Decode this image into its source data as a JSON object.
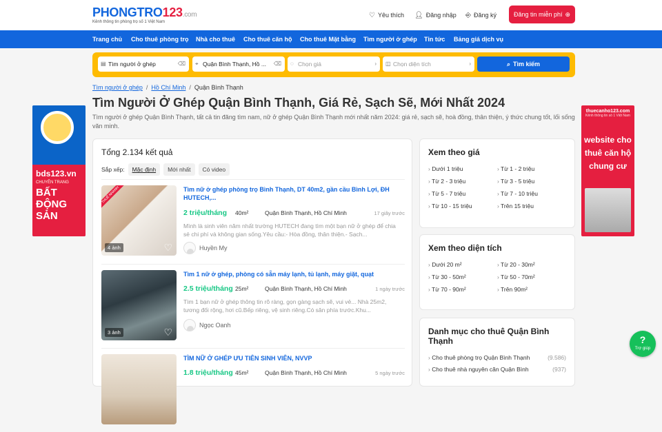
{
  "header": {
    "logo_main": "PHONGTRO",
    "logo_num": "123",
    "logo_domain": ".com",
    "tagline": "Kênh thông tin phòng trọ số 1 Việt Nam",
    "favorite": "Yêu thích",
    "login": "Đăng nhập",
    "register": "Đăng ký",
    "post_button": "Đăng tin miễn phí"
  },
  "menu": [
    "Trang chủ",
    "Cho thuê phòng trọ",
    "Nhà cho thuê",
    "Cho thuê căn hộ",
    "Cho thuê Mặt bằng",
    "Tìm người ở ghép",
    "Tin tức",
    "Bảng giá dịch vụ"
  ],
  "search": {
    "category": "Tìm người ở ghép",
    "location": "Quận Bình Thạnh, Hồ ...",
    "price_placeholder": "Chọn giá",
    "area_placeholder": "Chọn diện tích",
    "button": "Tìm kiếm"
  },
  "breadcrumb": [
    "Tìm người ở ghép",
    "Hồ Chí Minh",
    "Quận Bình Thạnh"
  ],
  "page": {
    "title": "Tìm Người Ở Ghép Quận Bình Thạnh, Giá Rẻ, Sạch Sẽ, Mới Nhất 2024",
    "description": "Tìm người ở ghép Quận Bình Thạnh, tất cả tin đăng tìm nam, nữ ở ghép Quận Bình Thạnh mới nhất năm 2024: giá rẻ, sạch sẽ, hoà đồng, thân thiện, ý thức chung tốt, lối sống văn minh."
  },
  "ads": {
    "left_brand": "bds123.vn",
    "left_tag": "CHUYÊN TRANG",
    "left_big": "BẤT ĐỘNG SẢN",
    "right_brand": "thuecanho123.com",
    "right_tag": "Kênh thông tin số 1 Việt Nam",
    "right_big": "website cho thuê căn hộ chung cư"
  },
  "results": {
    "total": "Tổng 2.134 kết quả",
    "sort_label": "Sắp xếp:",
    "sort_options": [
      "Mặc định",
      "Mới nhất",
      "Có video"
    ]
  },
  "listings": [
    {
      "title": "Tìm nữ ở ghép phòng trọ Bình Thạnh, DT 40m2, gần cầu Bình Lợi, ĐH HUTECH,...",
      "price": "2 triệu/tháng",
      "area": "40m²",
      "location": "Quận Bình Thạnh, Hồ Chí Minh",
      "time": "17 giây trước",
      "summary": "Mình là sinh viên năm nhất trường HUTECH đang tìm một bạn nữ ở ghép để chia sẻ chi phí và không gian sống.Yêu cầu:- Hòa đồng, thân thiện.- Sạch...",
      "author": "Huyền My",
      "photos": "4 ảnh",
      "ribbon": "THUÊ NHANH"
    },
    {
      "title": "Tìm 1 nữ ở ghép, phòng có sẵn máy lạnh, tủ lạnh, máy giặt, quạt",
      "price": "2.5 triệu/tháng",
      "area": "25m²",
      "location": "Quận Bình Thạnh, Hồ Chí Minh",
      "time": "1 ngày trước",
      "summary": "Tìm 1 bạn nữ ở ghép thông tin rõ ràng, gọn gàng sạch sẽ, vui vẻ... Nhà 25m2, tương đối rộng, hơi cũ.Bếp riêng, vệ sinh riêng.Có sân phía trước.Khu...",
      "author": "Ngọc Oanh",
      "photos": "3 ảnh"
    },
    {
      "title": "TÌM NỮ Ở GHÉP ƯU TIÊN SINH VIÊN, NVVP",
      "price": "1.8 triệu/tháng",
      "area": "45m²",
      "location": "Quận Bình Thạnh, Hồ Chí Minh",
      "time": "5 ngày trước"
    }
  ],
  "price_filter": {
    "title": "Xem theo giá",
    "items": [
      "Dưới 1 triệu",
      "Từ 1 - 2 triệu",
      "Từ 2 - 3 triệu",
      "Từ 3 - 5 triệu",
      "Từ 5 - 7 triệu",
      "Từ 7 - 10 triệu",
      "Từ 10 - 15 triệu",
      "Trên 15 triệu"
    ]
  },
  "area_filter": {
    "title": "Xem theo diện tích",
    "items": [
      "Dưới 20 m²",
      "Từ 20 - 30m²",
      "Từ 30 - 50m²",
      "Từ 50 - 70m²",
      "Từ 70 - 90m²",
      "Trên 90m²"
    ]
  },
  "categories": {
    "title": "Danh mục cho thuê Quận Bình Thạnh",
    "items": [
      {
        "name": "Cho thuê phòng trọ Quận Bình Thạnh",
        "count": "(9.586)"
      },
      {
        "name": "Cho thuê nhà nguyên căn Quận Bình",
        "count": "(937)"
      }
    ]
  },
  "help": {
    "symbol": "?",
    "label": "Trợ giúp"
  },
  "colors": {
    "primary": "#1266dd",
    "accent": "#e51f40",
    "search_bg": "#febb02",
    "price": "#16c784"
  }
}
